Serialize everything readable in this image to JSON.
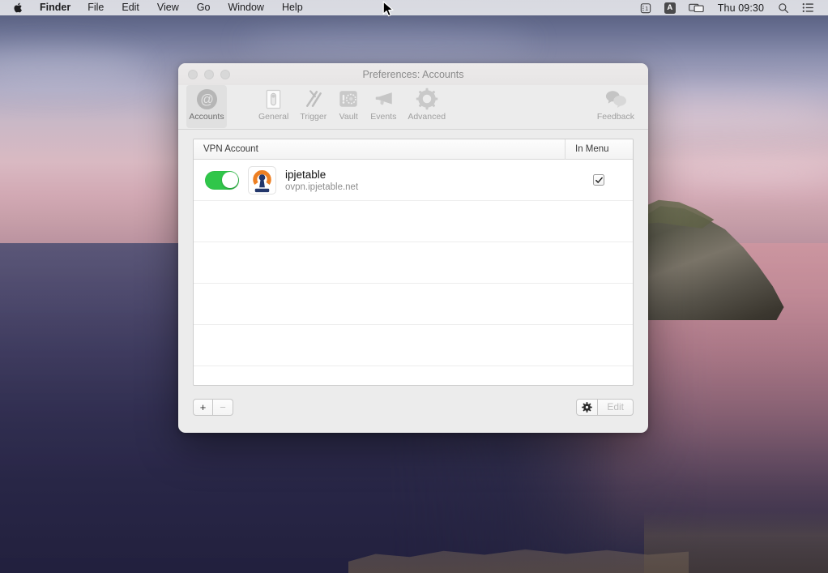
{
  "menubar": {
    "apple_icon": "apple-logo-icon",
    "items": [
      {
        "label": "Finder",
        "bold": true
      },
      {
        "label": "File",
        "bold": false
      },
      {
        "label": "Edit",
        "bold": false
      },
      {
        "label": "View",
        "bold": false
      },
      {
        "label": "Go",
        "bold": false
      },
      {
        "label": "Window",
        "bold": false
      },
      {
        "label": "Help",
        "bold": false
      }
    ],
    "status": {
      "calendar_day": "1",
      "input_source": "A",
      "screen_mirroring_icon": "screen-mirroring-icon",
      "clock": "Thu 09:30",
      "search_icon": "search-icon",
      "control_center_icon": "control-center-icon"
    }
  },
  "window": {
    "title": "Preferences: Accounts",
    "traffic_lights": [
      "close-button",
      "minimize-button",
      "zoom-button"
    ],
    "toolbar": [
      {
        "label": "Accounts",
        "icon": "at-sign-circle-icon",
        "selected": true
      },
      {
        "label": "General",
        "icon": "toggle-switch-icon",
        "selected": false
      },
      {
        "label": "Trigger",
        "icon": "arrow-slashes-icon",
        "selected": false
      },
      {
        "label": "Vault",
        "icon": "safe-icon",
        "selected": false
      },
      {
        "label": "Events",
        "icon": "megaphone-icon",
        "selected": false
      },
      {
        "label": "Advanced",
        "icon": "gear-icon",
        "selected": false
      },
      {
        "label": "Feedback",
        "icon": "speech-bubbles-icon",
        "selected": false
      }
    ],
    "table": {
      "columns": [
        "VPN Account",
        "In Menu"
      ],
      "rows": [
        {
          "enabled": true,
          "icon": "openvpn-logo-icon",
          "name": "ipjetable",
          "host": "ovpn.ipjetable.net",
          "in_menu": true
        }
      ],
      "empty_row_count": 5
    },
    "footer": {
      "add_label": "+",
      "remove_label": "−",
      "remove_disabled": true,
      "gear_icon": "gear-icon",
      "edit_label": "Edit",
      "edit_disabled": true
    }
  },
  "colors": {
    "toggle_on": "#30c64a",
    "openvpn_orange": "#ED7F22",
    "openvpn_navy": "#23376B",
    "window_chrome": "#ececec"
  }
}
